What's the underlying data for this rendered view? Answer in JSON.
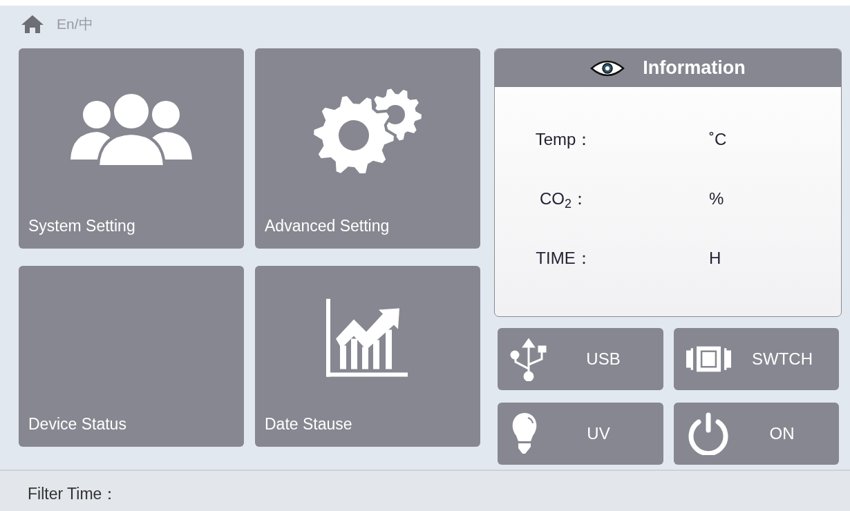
{
  "header": {
    "language_toggle": "En/中"
  },
  "tiles": [
    {
      "label": "System Setting"
    },
    {
      "label": "Advanced Setting"
    },
    {
      "label": "Device Status"
    },
    {
      "label": "Date Stause"
    }
  ],
  "information": {
    "title": "Information",
    "rows": [
      {
        "label": "Temp：",
        "unit": "˚C"
      },
      {
        "label": "CO$_{2}$：",
        "unit": "%"
      },
      {
        "label": "TIME：",
        "unit": "H"
      }
    ]
  },
  "buttons": [
    {
      "label": "USB"
    },
    {
      "label": "SWTCH"
    },
    {
      "label": "UV"
    },
    {
      "label": "ON"
    }
  ],
  "status_bar": {
    "label": "Filter Time："
  }
}
